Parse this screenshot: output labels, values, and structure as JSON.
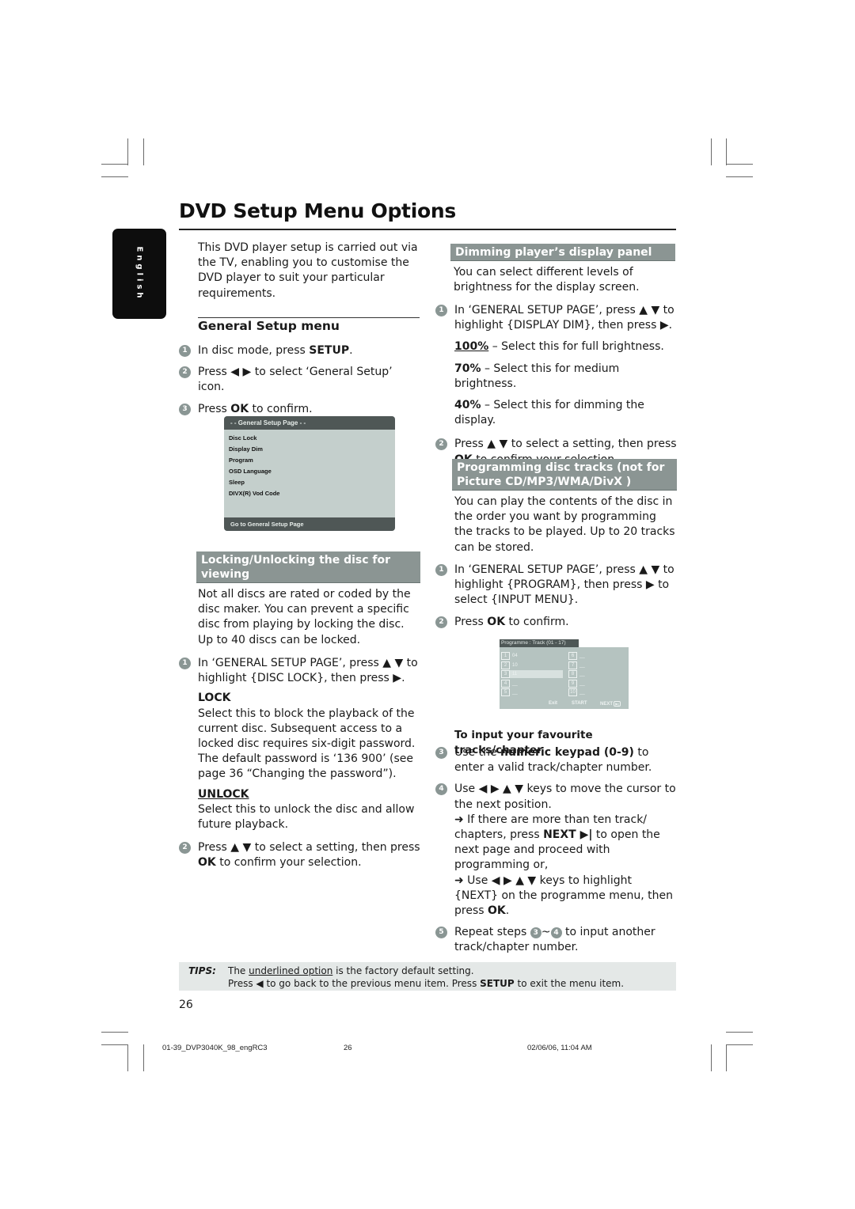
{
  "page": {
    "title": "DVD Setup Menu Options",
    "language_tab": "English",
    "page_number": "26"
  },
  "intro": "This DVD player setup is carried out via the TV, enabling you to customise the DVD player to suit your particular requirements.",
  "general_setup": {
    "heading": "General Setup menu",
    "steps": [
      {
        "num": "1",
        "pre": "In disc mode, press ",
        "bold": "SETUP",
        "post": "."
      },
      {
        "num": "2",
        "pre": "Press ◀ ▶ to select ‘General Setup’ icon.",
        "bold": "",
        "post": ""
      },
      {
        "num": "3",
        "pre": "Press ",
        "bold": "OK",
        "post": " to confirm."
      }
    ],
    "menu_screen": {
      "header": "- -   General Setup Page   - -",
      "items": [
        "Disc Lock",
        "Display Dim",
        "Program",
        "OSD Language",
        "Sleep",
        "DIVX(R) Vod Code"
      ],
      "footer": "Go to General Setup Page"
    }
  },
  "locking": {
    "heading": "Locking/Unlocking the disc for viewing",
    "body": "Not all discs are rated or coded by the disc maker. You can prevent a specific disc from playing by locking the disc.  Up to 40 discs can be locked.",
    "step1": {
      "num": "1",
      "text": "In ‘GENERAL SETUP PAGE’, press ▲ ▼ to highlight {DISC LOCK}, then press ▶."
    },
    "lock": {
      "label": "LOCK",
      "text": "Select this to block the playback of the current disc.  Subsequent access to a locked disc requires six-digit password. The default password is ‘136 900’ (see page 36 “Changing the password”)."
    },
    "unlock": {
      "label": "UNLOCK",
      "text": "Select this to unlock the disc and allow future playback."
    },
    "step2": {
      "num": "2",
      "pre": "Press ▲  ▼ to select a setting, then press ",
      "bold": "OK",
      "post": " to confirm your selection."
    }
  },
  "dimming": {
    "heading": "Dimming player’s display panel",
    "body": "You can select different levels of brightness for the display screen.",
    "step1": {
      "num": "1",
      "text": "In ‘GENERAL SETUP PAGE’, press ▲ ▼ to highlight {DISPLAY DIM}, then press ▶."
    },
    "options": [
      {
        "value": "100%",
        "text": " – Select this for full brightness.",
        "default": true
      },
      {
        "value": "70%",
        "text": " – Select this for medium brightness.",
        "default": false
      },
      {
        "value": "40%",
        "text": " – Select this for dimming the display.",
        "default": false
      }
    ],
    "step2": {
      "num": "2",
      "pre": "Press ▲ ▼  to select a setting, then press ",
      "bold": "OK",
      "post": " to confirm your selection."
    }
  },
  "programming": {
    "heading": "Programming disc tracks (not for Picture CD/MP3/WMA/DivX )",
    "body": "You can play the contents of the disc in the order you want by programming the tracks to be played. Up to 20 tracks can be stored.",
    "step1": {
      "num": "1",
      "text": "In ‘GENERAL SETUP PAGE’, press ▲ ▼ to highlight {PROGRAM}, then press ▶ to select {INPUT MENU}."
    },
    "step2": {
      "num": "2",
      "pre": "Press ",
      "bold": "OK",
      "post": " to confirm."
    },
    "programme_screen": {
      "header": "Programme : Track (01 - 17)",
      "slots": [
        {
          "n": "1",
          "v": "04"
        },
        {
          "n": "2",
          "v": "10"
        },
        {
          "n": "3",
          "v": "11"
        },
        {
          "n": "4",
          "v": "__"
        },
        {
          "n": "5",
          "v": "__"
        },
        {
          "n": "6",
          "v": "__"
        },
        {
          "n": "7",
          "v": "__"
        },
        {
          "n": "8",
          "v": "__"
        },
        {
          "n": "9",
          "v": "__"
        },
        {
          "n": "10",
          "v": "__"
        }
      ],
      "selected_slot": "3",
      "buttons": {
        "exit": "Exit",
        "start": "START",
        "next": "NEXT"
      }
    },
    "subheading": "To input your favourite tracks/chapter",
    "step3": {
      "num": "3",
      "pre": "Use the ",
      "bold": "numeric keypad (0-9)",
      "post": " to enter a valid track/chapter number."
    },
    "step4": {
      "num": "4",
      "text": "Use ◀ ▶ ▲ ▼ keys to move the cursor to the next position.",
      "note1_pre": "➜ If there are more than ten track/ chapters, press ",
      "note1_bold": "NEXT ▶|",
      "note1_post": " to open the next page and proceed with programming or,",
      "note2_pre": "➜ Use ◀ ▶ ▲ ▼ keys to highlight {NEXT} on the programme menu, then press ",
      "note2_bold": "OK",
      "note2_post": "."
    },
    "step5": {
      "num": "5",
      "pre": "Repeat steps ",
      "ref_a": "3",
      "tilde": "~",
      "ref_b": "4",
      "post": " to input another track/chapter number."
    }
  },
  "tips": {
    "label": "TIPS:",
    "line1_pre": "The ",
    "line1_underlined": "underlined option",
    "line1_post": " is the factory default setting.",
    "line2_pre": "Press ◀ to go back to the previous menu item. Press ",
    "line2_bold": "SETUP",
    "line2_post": " to exit the menu item."
  },
  "footer": {
    "file": "01-39_DVP3040K_98_engRC3",
    "page": "26",
    "datetime": "02/06/06, 11:04 AM"
  }
}
